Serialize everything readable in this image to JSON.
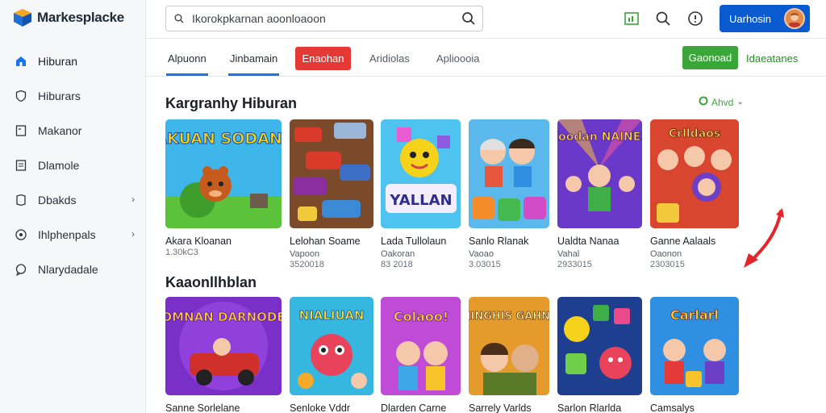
{
  "app": {
    "logo_text": "Markesplacke"
  },
  "search": {
    "placeholder": "Ikorokpkarnan aoonloaoon"
  },
  "header": {
    "account_label": "Uarhosin"
  },
  "sidebar": {
    "items": [
      {
        "label": "Hiburan",
        "icon": "home-icon",
        "chevron": false
      },
      {
        "label": "Hiburars",
        "icon": "shield-icon",
        "chevron": false
      },
      {
        "label": "Makanor",
        "icon": "document-icon",
        "chevron": false
      },
      {
        "label": "Dlamole",
        "icon": "list-icon",
        "chevron": false
      },
      {
        "label": "Dbakds",
        "icon": "bookmark-icon",
        "chevron": true
      },
      {
        "label": "Ihlphenpals",
        "icon": "compass-icon",
        "chevron": true
      },
      {
        "label": "Nlarydadale",
        "icon": "chat-icon",
        "chevron": false
      }
    ]
  },
  "tabs": {
    "items": [
      "Alpuonn",
      "Jinbamain",
      "Enaohan",
      "Aridiolas",
      "Aplioooia"
    ],
    "green_button": "Gaonoad",
    "green_link": "Idaeatanes"
  },
  "sections": {
    "first": {
      "title": "Kargranhy Hiburan",
      "filter_label": "Ahvd",
      "cards": [
        {
          "title": "Akara Kloanan",
          "sub": "",
          "meta": "1.30kC3",
          "art": "KAKUAN SODANES"
        },
        {
          "title": "Lelohan Soame",
          "sub": "Vapoon",
          "meta": "3520018",
          "art": ""
        },
        {
          "title": "Lada Tullolaun",
          "sub": "Oakoran",
          "meta": "83 2018",
          "art": "YALLAN"
        },
        {
          "title": "Sanlo Rlanak",
          "sub": "Vaoao",
          "meta": "3.03015",
          "art": ""
        },
        {
          "title": "Ualdta Nanaa",
          "sub": "Vahal",
          "meta": "2933015",
          "art": "Koodan NAlNES"
        },
        {
          "title": "Ganne Aalaals",
          "sub": "Oaonon",
          "meta": "2303015",
          "art": "Crlldaos"
        }
      ]
    },
    "second": {
      "title": "Kaaonllhblan",
      "cards": [
        {
          "title": "Sanne Sorlelane",
          "art": "SOMNAN DARNODES"
        },
        {
          "title": "Senloke Vddr",
          "art": "NIALIUAN"
        },
        {
          "title": "Dlarden Carne",
          "art": "Colaoo!"
        },
        {
          "title": "Sarrely Varlds",
          "art": "MINGHIS GAHNS"
        },
        {
          "title": "Sarlon Rlarlda",
          "art": ""
        },
        {
          "title": "Camsalys",
          "art": "Carlarl"
        }
      ]
    }
  },
  "colors": {
    "accent": "#1a73e8",
    "brand_blue": "#0b5bd0",
    "red": "#e53935",
    "green": "#3aa63a"
  }
}
